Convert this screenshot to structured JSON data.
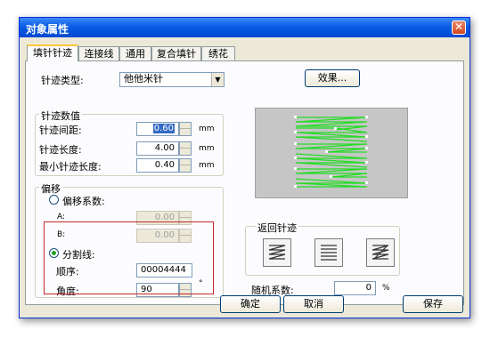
{
  "window": {
    "title": "对象属性"
  },
  "tabs": [
    {
      "label": "填针针迹"
    },
    {
      "label": "连接线"
    },
    {
      "label": "通用"
    },
    {
      "label": "复合填针"
    },
    {
      "label": "绣花"
    }
  ],
  "stitch_type": {
    "label": "针迹类型:",
    "value": "他他米针"
  },
  "effect_button": {
    "label": "效果..."
  },
  "stitch_values": {
    "title": "针迹数值",
    "spacing": {
      "label": "针迹间距:",
      "value": "0.60",
      "unit": "mm"
    },
    "length": {
      "label": "针迹长度:",
      "value": "4.00",
      "unit": "mm"
    },
    "min_length": {
      "label": "最小针迹长度:",
      "value": "0.40",
      "unit": "mm"
    }
  },
  "offset": {
    "title": "偏移",
    "coef_radio": {
      "label": "偏移系数:"
    },
    "a": {
      "label": "A:",
      "value": "0.00"
    },
    "b": {
      "label": "B:",
      "value": "0.00"
    },
    "divider_radio": {
      "label": "分割线:"
    },
    "order": {
      "label": "顺序:",
      "value": "00004444"
    },
    "angle": {
      "label": "角度:",
      "value": "90",
      "unit": "°"
    }
  },
  "return_stitch": {
    "title": "返回针迹"
  },
  "random": {
    "label": "随机系数:",
    "value": "0",
    "unit": "%"
  },
  "footer": {
    "ok": "确定",
    "cancel": "取消",
    "save": "保存"
  },
  "colors": {
    "preview_bg": "#c6c6c6",
    "stitch_line": "#22dd22",
    "highlight": "#c62828"
  }
}
